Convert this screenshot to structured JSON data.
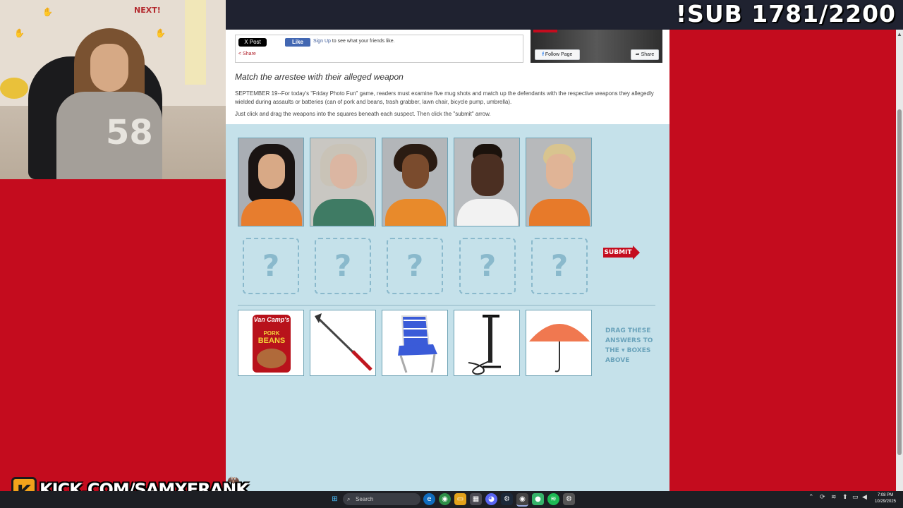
{
  "overlay": {
    "sub_counter": "!SUB 1781/2200",
    "kick_url": "KICK.COM/SAMXFRANK",
    "kick_logo": "K"
  },
  "webcam": {
    "wall_text": "NEXT!"
  },
  "article": {
    "x_post_label": "X Post",
    "fb_like_label": "Like",
    "fb_signup_link": "Sign Up",
    "fb_signup_text": "to see what your friends like.",
    "share_label": "Share",
    "fb_follow_label": "Follow Page",
    "fb_share_label": "Share",
    "headline": "Match the arrestee with their alleged weapon",
    "paragraph1": "SEPTEMBER 19--For today's \"Friday Photo Fun\" game, readers must examine five mug shots and match up the defendants with the respective weapons they allegedly wielded during assaults or batteries (can of pork and beans, trash grabber, lawn chair, bicycle pump, umbrella).",
    "paragraph2": "Just click and drag the weapons into the squares beneath each suspect. Then click the \"submit\" arrow."
  },
  "game": {
    "slot_symbol": "?",
    "submit_label": "SUBMIT",
    "drag_hint": "DRAG THESE ANSWERS TO THE ▾ BOXES ABOVE",
    "weapon_can_text": [
      "Van Camp's",
      "PORK",
      "BEANS"
    ]
  },
  "taskbar": {
    "search_placeholder": "Search",
    "clock_time": "7:08 PM",
    "clock_date": "10/29/2025"
  },
  "colors": {
    "background_red": "#c40c1e",
    "game_bg": "#c5e1ea",
    "accent_blue": "#6aa3bb"
  }
}
